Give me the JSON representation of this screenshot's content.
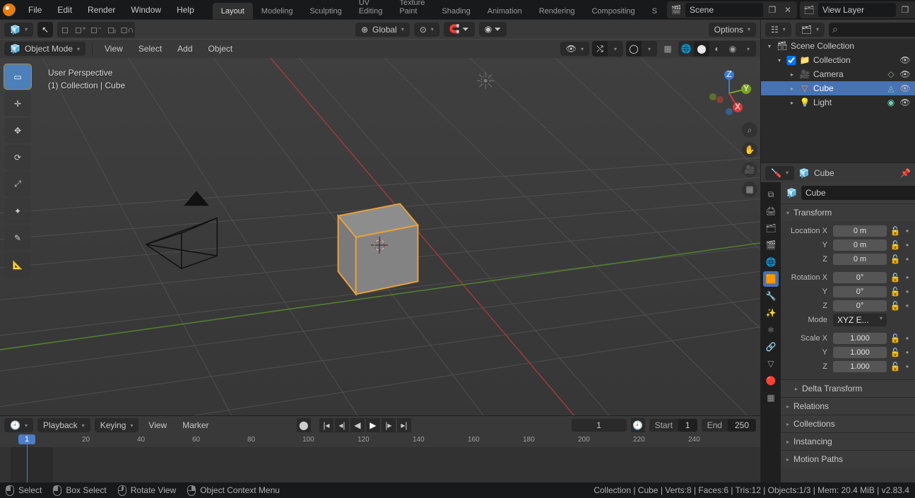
{
  "top_menu": [
    "File",
    "Edit",
    "Render",
    "Window",
    "Help"
  ],
  "workspaces": {
    "tabs": [
      "Layout",
      "Modeling",
      "Sculpting",
      "UV Editing",
      "Texture Paint",
      "Shading",
      "Animation",
      "Rendering",
      "Compositing",
      "S"
    ],
    "active": "Layout",
    "overflow": "+"
  },
  "scene_field": "Scene",
  "view_layer_field": "View Layer",
  "viewport": {
    "orientation": "Global",
    "options_label": "Options",
    "mode": "Object Mode",
    "menus": [
      "View",
      "Select",
      "Add",
      "Object"
    ],
    "overlay_line1": "User Perspective",
    "overlay_line2": "(1) Collection | Cube",
    "axes": {
      "x": "X",
      "y": "Y",
      "z": "Z"
    }
  },
  "outliner": {
    "root": "Scene Collection",
    "collection": "Collection",
    "items": [
      "Camera",
      "Cube",
      "Light"
    ],
    "selected": "Cube"
  },
  "properties": {
    "breadcrumb": "Cube",
    "object_name": "Cube",
    "panels": {
      "transform": "Transform",
      "delta": "Delta Transform",
      "relations": "Relations",
      "collections": "Collections",
      "instancing": "Instancing",
      "motion": "Motion Paths"
    },
    "location": {
      "label": "Location X",
      "y": "Y",
      "z": "Z",
      "vx": "0 m",
      "vy": "0 m",
      "vz": "0 m"
    },
    "rotation": {
      "label": "Rotation X",
      "y": "Y",
      "z": "Z",
      "vx": "0°",
      "vy": "0°",
      "vz": "0°",
      "mode_label": "Mode",
      "mode_val": "XYZ E..."
    },
    "scale": {
      "label": "Scale X",
      "y": "Y",
      "z": "Z",
      "vx": "1.000",
      "vy": "1.000",
      "vz": "1.000"
    }
  },
  "timeline": {
    "menus_playback": "Playback",
    "menus_keying": "Keying",
    "menus_view": "View",
    "menus_marker": "Marker",
    "current_frame": "1",
    "start_label": "Start",
    "start_val": "1",
    "end_label": "End",
    "end_val": "250",
    "ticks": [
      "20",
      "40",
      "60",
      "80",
      "100",
      "120",
      "140",
      "160",
      "180",
      "200",
      "220",
      "240"
    ]
  },
  "status": {
    "select": "Select",
    "box_select": "Box Select",
    "rotate": "Rotate View",
    "context_menu": "Object Context Menu",
    "info": "Collection | Cube | Verts:8 | Faces:6 | Tris:12 | Objects:1/3 | Mem: 20.4 MiB | v2.83.4"
  }
}
